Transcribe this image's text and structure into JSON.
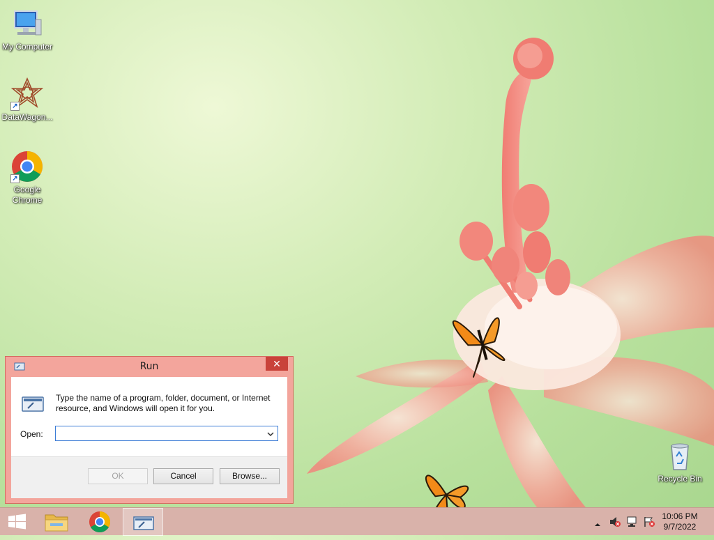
{
  "desktop": {
    "icons": [
      {
        "label": "My Computer",
        "icon": "computer-icon"
      },
      {
        "label": "DataWagon...",
        "icon": "datawagon-icon"
      },
      {
        "label": "Google Chrome",
        "icon": "chrome-icon"
      },
      {
        "label": "Recycle Bin",
        "icon": "recycle-bin-icon"
      }
    ]
  },
  "run_dialog": {
    "title": "Run",
    "close_glyph": "✕",
    "description": "Type the name of a program, folder, document, or Internet resource, and Windows will open it for you.",
    "open_label": "Open:",
    "open_value": "",
    "buttons": {
      "ok": "OK",
      "cancel": "Cancel",
      "browse": "Browse..."
    },
    "ok_enabled": false
  },
  "taskbar": {
    "pinned": [
      "start-button",
      "file-explorer",
      "google-chrome",
      "run"
    ],
    "active": "run",
    "clock": {
      "time": "10:06 PM",
      "date": "9/7/2022"
    },
    "tray": [
      "show-hidden-icons",
      "volume-muted",
      "network",
      "action-center"
    ]
  },
  "colors": {
    "taskbar": "#d9b2aa",
    "dialog_frame": "#f3a59c",
    "close_button": "#c9423a",
    "wallpaper_green": "#c8e8ac"
  }
}
